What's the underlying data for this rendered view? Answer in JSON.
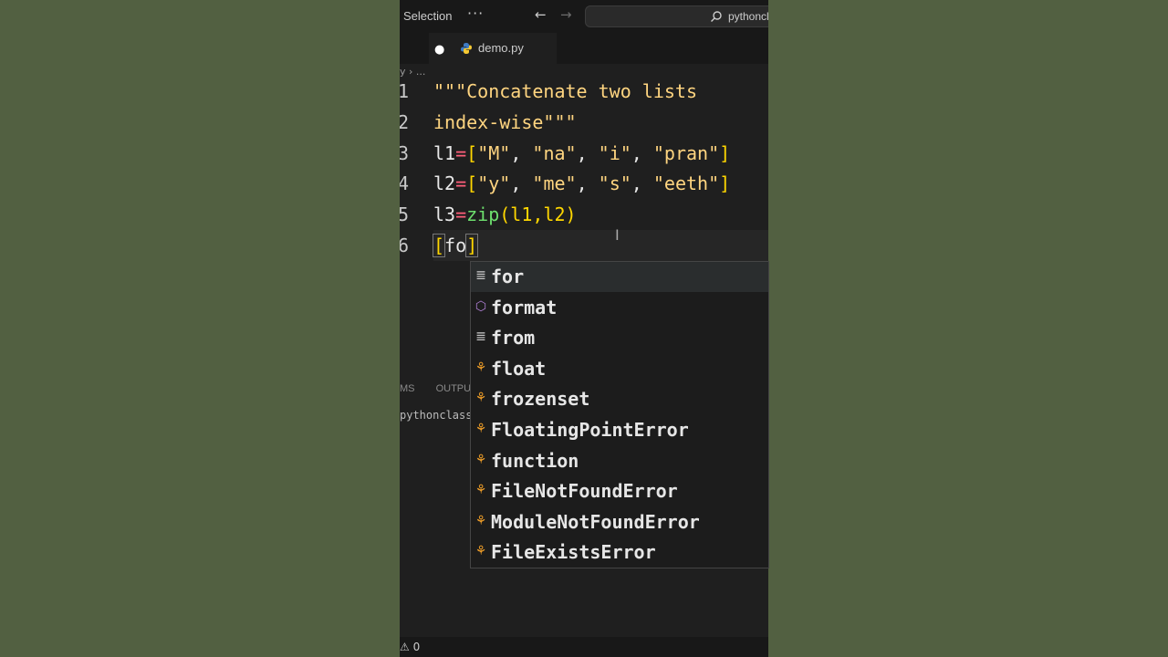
{
  "titlebar": {
    "menu_label": "Selection",
    "more": "···",
    "back": "←",
    "forward": "→",
    "search_text": "pythoncl"
  },
  "tab": {
    "modified_dot": "●",
    "filename": "demo.py"
  },
  "breadcrumb": "y › ...",
  "gutter": [
    "1",
    "2",
    "3",
    "4",
    "5",
    "6"
  ],
  "code": {
    "l1": "\"\"\"Concatenate two lists",
    "l2": "index-wise\"\"\"",
    "l3_name": "l1",
    "l3_items": [
      "\"M\"",
      "\"na\"",
      "\"i\"",
      "\"pran\""
    ],
    "l4_name": "l2",
    "l4_items": [
      "\"y\"",
      "\"me\"",
      "\"s\"",
      "\"eeth\""
    ],
    "l5_name": "l3",
    "l5_fn": "zip",
    "l5_args": "(l1,l2)",
    "l6_typed": "fo"
  },
  "panel": {
    "tabs_left": "MS",
    "tabs_output": "OUTPUT",
    "terminal_text": "pythonclass"
  },
  "status": {
    "text": "⚠ 0"
  },
  "suggestions": [
    {
      "label": "for",
      "kind": "keyword",
      "selected": true
    },
    {
      "label": "format",
      "kind": "method",
      "selected": false
    },
    {
      "label": "from",
      "kind": "keyword",
      "selected": false
    },
    {
      "label": "float",
      "kind": "class",
      "selected": false
    },
    {
      "label": "frozenset",
      "kind": "class",
      "selected": false
    },
    {
      "label": "FloatingPointError",
      "kind": "class",
      "selected": false
    },
    {
      "label": "function",
      "kind": "class",
      "selected": false
    },
    {
      "label": "FileNotFoundError",
      "kind": "class",
      "selected": false
    },
    {
      "label": "ModuleNotFoundError",
      "kind": "class",
      "selected": false
    },
    {
      "label": "FileExistsError",
      "kind": "class",
      "selected": false
    }
  ],
  "colors": {
    "keyword_icon": "#cccccc",
    "method_icon": "#b180d7",
    "class_icon": "#ee9d28"
  }
}
